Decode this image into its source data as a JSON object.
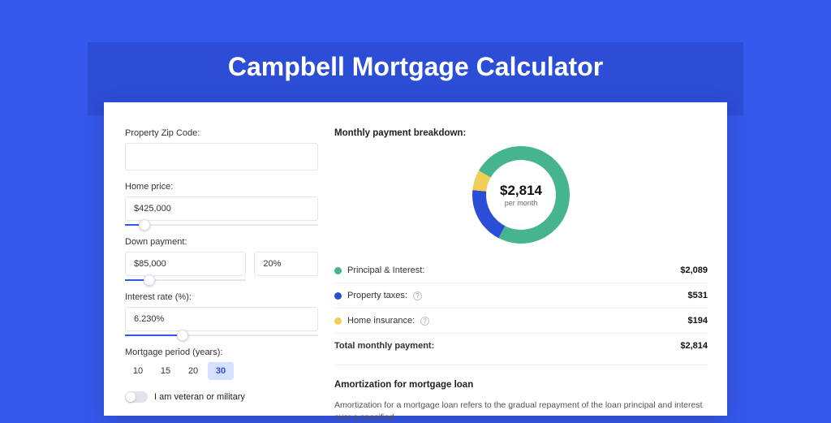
{
  "title": "Campbell Mortgage Calculator",
  "form": {
    "zip": {
      "label": "Property Zip Code:",
      "value": ""
    },
    "homePrice": {
      "label": "Home price:",
      "value": "$425,000",
      "sliderPct": 10
    },
    "downPayment": {
      "label": "Down payment:",
      "amount": "$85,000",
      "pct": "20%",
      "sliderPct": 20
    },
    "rate": {
      "label": "Interest rate (%):",
      "value": "6.230%",
      "sliderPct": 30
    },
    "period": {
      "label": "Mortgage period (years):",
      "options": [
        "10",
        "15",
        "20",
        "30"
      ],
      "selected": "30"
    },
    "veteran": {
      "label": "I am veteran or military",
      "on": false
    }
  },
  "breakdown": {
    "heading": "Monthly payment breakdown:",
    "total": {
      "label": "Total monthly payment:",
      "amount": "$2,814",
      "sub": "per month"
    },
    "items": [
      {
        "key": "pi",
        "label": "Principal & Interest:",
        "amount": "$2,089",
        "color": "#46b48e",
        "pct": 74.3,
        "help": false
      },
      {
        "key": "tax",
        "label": "Property taxes:",
        "amount": "$531",
        "color": "#2c4dd6",
        "pct": 18.9,
        "help": true
      },
      {
        "key": "ins",
        "label": "Home insurance:",
        "amount": "$194",
        "color": "#f1cf57",
        "pct": 6.8,
        "help": true
      }
    ]
  },
  "amort": {
    "heading": "Amortization for mortgage loan",
    "body": "Amortization for a mortgage loan refers to the gradual repayment of the loan principal and interest over a specified"
  },
  "chart_data": {
    "type": "pie",
    "title": "Monthly payment breakdown",
    "categories": [
      "Principal & Interest",
      "Property taxes",
      "Home insurance"
    ],
    "values": [
      2089,
      531,
      194
    ],
    "colors": [
      "#46b48e",
      "#2c4dd6",
      "#f1cf57"
    ],
    "total": 2814,
    "center_label": "$2,814 per month"
  }
}
